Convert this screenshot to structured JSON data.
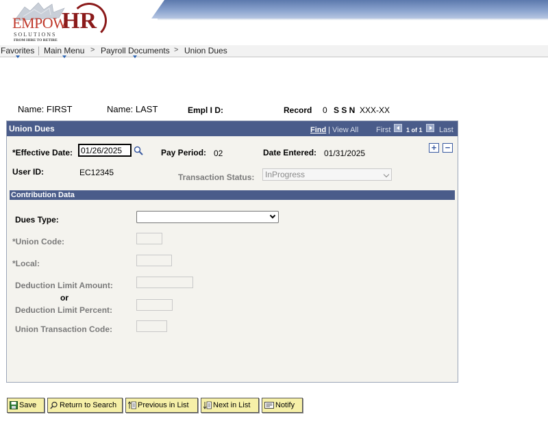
{
  "header": {
    "logo_text_empow": "EMPOW",
    "logo_text_hr": "HR",
    "logo_solutions": "SOLUTIONS",
    "logo_tagline": "FROM HIRE TO RETIRE"
  },
  "nav": {
    "favorites": "Favorites",
    "main_menu": "Main Menu",
    "payroll_documents": "Payroll Documents",
    "union_dues": "Union Dues"
  },
  "employee": {
    "first_name_label": "Name: FIRST",
    "last_name_label": "Name: LAST",
    "emplid_label": "Empl I D:",
    "record_label": "Record",
    "record_value": "0",
    "ssn_label": "S S N",
    "ssn_value": "XXX-XX"
  },
  "panel": {
    "title": "Union Dues",
    "find": "Find",
    "view_all": "View All",
    "first": "First",
    "position": "1 of 1",
    "last": "Last",
    "add_icon": "plus-icon",
    "remove_icon": "minus-icon"
  },
  "form": {
    "effective_date_label": "*Effective Date:",
    "effective_date_value": "01/26/2025",
    "pay_period_label": "Pay Period:",
    "pay_period_value": "02",
    "date_entered_label": "Date Entered:",
    "date_entered_value": "01/31/2025",
    "user_id_label": "User ID:",
    "user_id_value": "EC12345",
    "transaction_status_label": "Transaction Status:",
    "transaction_status_value": "InProgress"
  },
  "contribution": {
    "section_title": "Contribution Data",
    "dues_type_label": "Dues Type:",
    "dues_type_value": "",
    "union_code_label": "*Union Code:",
    "local_label": "*Local:",
    "deduction_limit_amount_label": "Deduction Limit Amount:",
    "or_label": "or",
    "deduction_limit_percent_label": "Deduction Limit Percent:",
    "union_transaction_code_label": "Union Transaction Code:"
  },
  "toolbar": {
    "save": "Save",
    "return_to_search": "Return to Search",
    "previous_in_list": "Previous in List",
    "next_in_list": "Next in List",
    "notify": "Notify"
  },
  "colors": {
    "panel_header": "#4a5c8a",
    "panel_bg": "#f4f3ee",
    "button_bg": "#f6f0a8"
  }
}
